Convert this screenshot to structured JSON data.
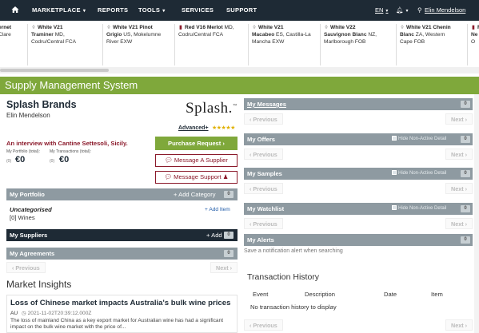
{
  "nav": {
    "items": [
      {
        "label": "MARKETPLACE",
        "caret": true
      },
      {
        "label": "REPORTS",
        "caret": false
      },
      {
        "label": "TOOLS",
        "caret": true
      },
      {
        "label": "SERVICES",
        "caret": false
      },
      {
        "label": "SUPPORT",
        "caret": false
      }
    ],
    "lang": "EN",
    "user": "Elin Mendelson"
  },
  "ticker": [
    {
      "lines": [
        "ernet",
        "Clare"
      ],
      "bold_first": true
    },
    {
      "icon": "white",
      "title": "White V21",
      "lines": [
        "Traminer MD,",
        "Codru/Central  FCA"
      ],
      "second_bold_word": "Traminer"
    },
    {
      "icon": "white",
      "title": "White V21 Pinot",
      "lines": [
        "Grigio US, Mokelumne",
        "River  EXW"
      ],
      "second_bold_word": "Grigio"
    },
    {
      "icon": "red",
      "title": "Red V16 Merlot",
      "title_suffix": " MD,",
      "lines": [
        "Codru/Central  FCA"
      ]
    },
    {
      "icon": "white",
      "title": "White V21",
      "lines": [
        "Macabeo ES, Castilla-La",
        "Mancha  EXW"
      ],
      "second_bold_word": "Macabeo"
    },
    {
      "icon": "white",
      "title": "White V22",
      "lines": [
        "Sauvignon Blanc NZ,",
        "Marlborough  FOB"
      ],
      "second_bold_word": "Sauvignon Blanc"
    },
    {
      "icon": "white",
      "title": "White V21 Chenin",
      "lines": [
        "Blanc ZA, Western",
        "Cape  FOB"
      ],
      "second_bold_word": "Blanc"
    },
    {
      "icon": "red",
      "title": "R",
      "lines": [
        "Ne",
        "O"
      ]
    }
  ],
  "banner": "Supply Management System",
  "brand": {
    "name": "Splash Brands",
    "user": "Elin Mendelson",
    "logo": "Splash.",
    "level": "Advanced+",
    "stars": "★★★★★",
    "interview": "An interview with Cantine Settesoli, Sicily.",
    "portfolio_label": "My Portfolio (total):",
    "portfolio_value": "€0",
    "portfolio_count": "(0)",
    "transactions_label": "My Transactions (total):",
    "transactions_value": "€0",
    "transactions_count": "(0)"
  },
  "actions": {
    "purchase_request": "Purchase Request ›",
    "message_supplier": "Message A Supplier",
    "message_support": "Message Support"
  },
  "portfolio": {
    "title": "My Portfolio",
    "add_category": "+ Add Category",
    "count": "0",
    "category": "Uncategorised",
    "wines": "[0] Wines",
    "add_item": "+ Add Item"
  },
  "suppliers": {
    "title": "My Suppliers",
    "add": "+ Add",
    "count": "0"
  },
  "agreements": {
    "title": "My Agreements",
    "count": "0",
    "previous": "‹ Previous",
    "next": "Next ›"
  },
  "market": {
    "title": "Market Insights",
    "headline": "Loss of Chinese market impacts Australia's bulk wine prices",
    "country": "AU",
    "timestamp": "2021-11-02T20:39:12.000Z",
    "body": "The loss of mainland China as a key export market for Australian wine has had a significant impact on the bulk wine market with the price of..."
  },
  "right": {
    "messages": {
      "title": "My Messages",
      "count": "0"
    },
    "offers": {
      "title": "My Offers",
      "count": "0",
      "hide": "Hide Non-Active Detail"
    },
    "samples": {
      "title": "My Samples",
      "count": "0",
      "hide": "Hide Non-Active Detail"
    },
    "watchlist": {
      "title": "My Watchlist",
      "count": "0",
      "hide": "Hide Non-Active Detail"
    },
    "alerts": {
      "title": "My Alerts",
      "count": "0",
      "text": "Save a notification alert when searching"
    },
    "previous": "‹ Previous",
    "next": "Next ›"
  },
  "transactions": {
    "title": "Transaction History",
    "columns": [
      "Event",
      "Description",
      "Date",
      "Item"
    ],
    "empty": "No transaction history to display",
    "previous": "‹ Previous",
    "next": "Next ›"
  },
  "colors": {
    "navy": "#1e2a35",
    "green": "#7fa83b",
    "maroon": "#8b1a2b",
    "grey_bar": "#8e9aa1"
  }
}
